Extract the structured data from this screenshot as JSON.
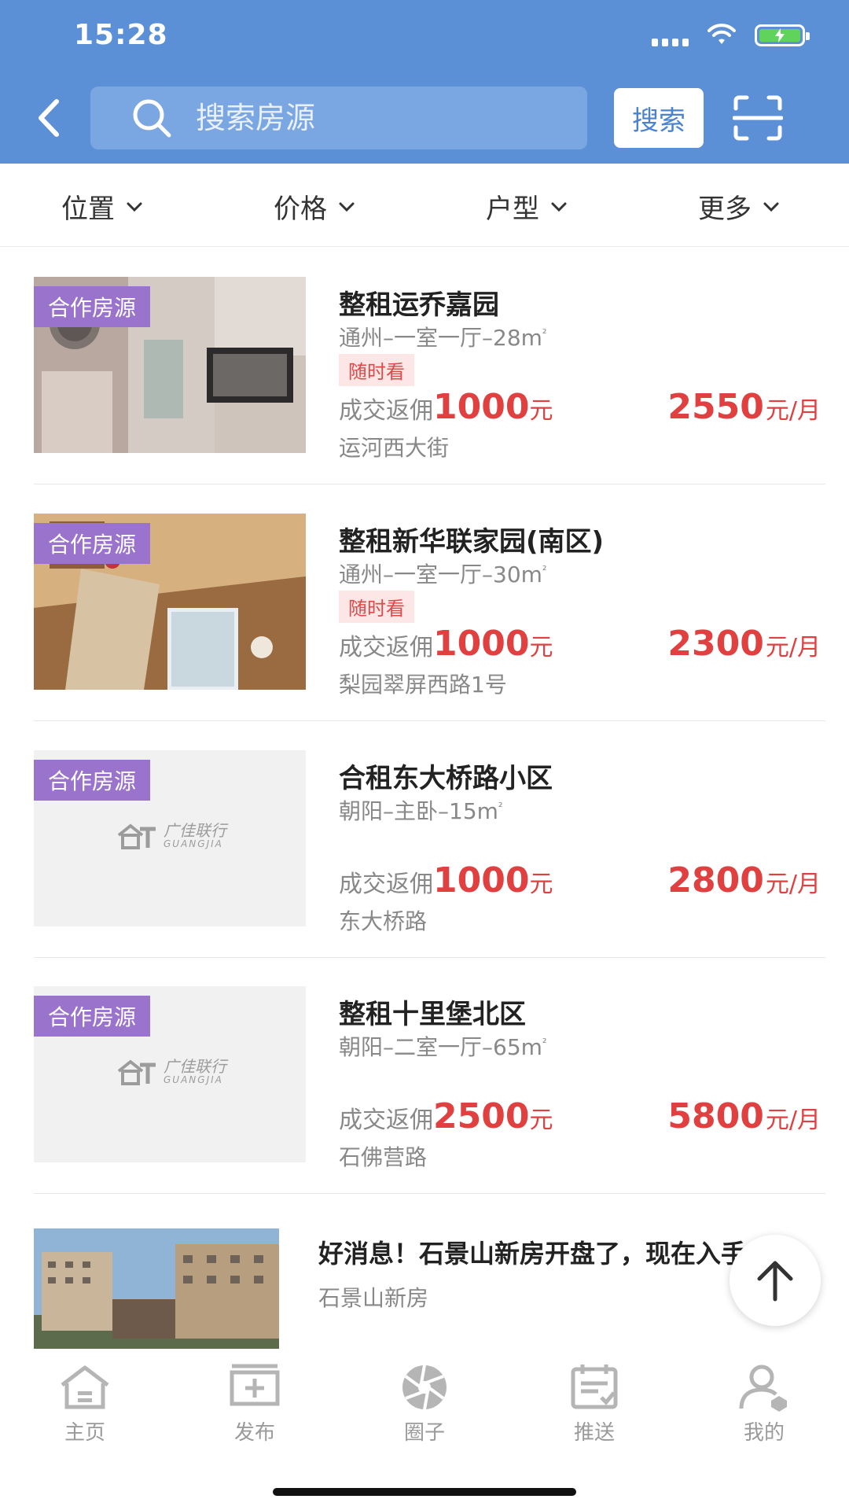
{
  "status_bar": {
    "time": "15:28",
    "icons": [
      "signal-icon",
      "wifi-icon",
      "battery-charging-icon"
    ]
  },
  "header": {
    "back_icon": "chevron-left-icon",
    "search_placeholder": "搜索房源",
    "search_button": "搜索",
    "scan_icon": "scan-icon"
  },
  "filters": [
    {
      "label": "位置"
    },
    {
      "label": "价格"
    },
    {
      "label": "户型"
    },
    {
      "label": "更多"
    }
  ],
  "listings": [
    {
      "tag": "合作房源",
      "title": "整租运乔嘉园",
      "desc": "通州–一室一厅–28m",
      "desc_sup": "²",
      "view_tag": "随时看",
      "rebate_label": "成交返佣",
      "rebate_amount": "1000",
      "rebate_unit": "元",
      "price": "2550",
      "price_unit": "元/月",
      "street": "运河西大街"
    },
    {
      "tag": "合作房源",
      "title": "整租新华联家园(南区)",
      "desc": "通州–一室一厅–30m",
      "desc_sup": "²",
      "view_tag": "随时看",
      "rebate_label": "成交返佣",
      "rebate_amount": "1000",
      "rebate_unit": "元",
      "price": "2300",
      "price_unit": "元/月",
      "street": "梨园翠屏西路1号"
    },
    {
      "tag": "合作房源",
      "title": "合租东大桥路小区",
      "desc": "朝阳–主卧–15m",
      "desc_sup": "²",
      "rebate_label": "成交返佣",
      "rebate_amount": "1000",
      "rebate_unit": "元",
      "price": "2800",
      "price_unit": "元/月",
      "street": "东大桥路",
      "placeholder_logo": "广佳联行",
      "placeholder_logo_en": "GUANGJIA"
    },
    {
      "tag": "合作房源",
      "title": "整租十里堡北区",
      "desc": "朝阳–二室一厅–65m",
      "desc_sup": "²",
      "rebate_label": "成交返佣",
      "rebate_amount": "2500",
      "rebate_unit": "元",
      "price": "5800",
      "price_unit": "元/月",
      "street": "石佛营路",
      "placeholder_logo": "广佳联行",
      "placeholder_logo_en": "GUANGJIA"
    }
  ],
  "news": {
    "title": "好消息！石景山新房开盘了，现在入手太",
    "subtitle": "石景山新房"
  },
  "tabbar": [
    {
      "label": "主页",
      "icon": "home-icon"
    },
    {
      "label": "发布",
      "icon": "publish-icon"
    },
    {
      "label": "圈子",
      "icon": "circle-aperture-icon"
    },
    {
      "label": "推送",
      "icon": "push-icon"
    },
    {
      "label": "我的",
      "icon": "profile-icon"
    }
  ],
  "colors": {
    "header_blue": "#5b8fd6",
    "price_red": "#e04040",
    "coop_purple": "#9a73cc"
  }
}
